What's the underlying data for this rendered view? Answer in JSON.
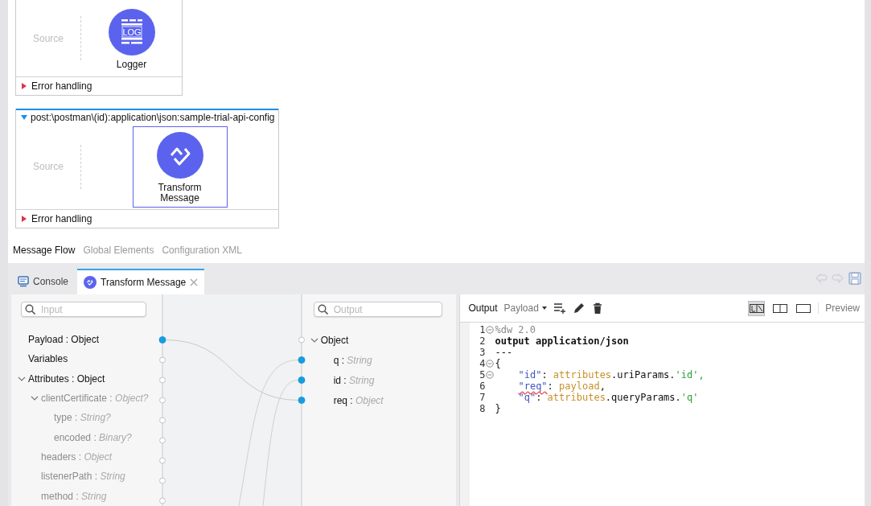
{
  "flows": [
    {
      "source_label": "Source",
      "processor": {
        "label": "Logger",
        "kind": "logger",
        "icon_text": "LOG",
        "selected": false
      },
      "error_handling": {
        "label": "Error handling",
        "expanded": false
      }
    },
    {
      "title": "post:\\postman\\(id):application\\json:sample-trial-api-config",
      "expanded": true,
      "source_label": "Source",
      "processor": {
        "label": "Transform Message",
        "kind": "transform",
        "selected": true
      },
      "error_handling": {
        "label": "Error handling",
        "expanded": false
      }
    }
  ],
  "canvas_tabs": [
    {
      "label": "Message Flow",
      "selected": true
    },
    {
      "label": "Global Elements",
      "selected": false
    },
    {
      "label": "Configuration XML",
      "selected": false
    }
  ],
  "views": [
    {
      "label": "Console",
      "kind": "console",
      "selected": false,
      "closable": false
    },
    {
      "label": "Transform Message",
      "kind": "transform",
      "selected": true,
      "closable": true
    }
  ],
  "input": {
    "search": {
      "placeholder": "Input"
    },
    "items": [
      {
        "name": "Payload : Object",
        "connected": true
      },
      {
        "name": "Variables",
        "connected": false
      },
      {
        "name": "Attributes : Object",
        "connected": false,
        "expanded": true,
        "children": [
          {
            "name": "clientCertificate :",
            "type": "Object?",
            "connected": false,
            "expanded": true,
            "children": [
              {
                "name": "type :",
                "type": "String?",
                "connected": false
              },
              {
                "name": "encoded :",
                "type": "Binary?",
                "connected": false
              }
            ]
          },
          {
            "name": "headers :",
            "type": "Object",
            "connected": false
          },
          {
            "name": "listenerPath :",
            "type": "String",
            "connected": false
          },
          {
            "name": "method :",
            "type": "String",
            "connected": false
          }
        ]
      }
    ]
  },
  "output": {
    "search": {
      "placeholder": "Output"
    },
    "items": [
      {
        "name": "Object",
        "connected": false,
        "expanded": true,
        "children": [
          {
            "name": "q :",
            "type": "String",
            "connected": true
          },
          {
            "name": "id :",
            "type": "String",
            "connected": true
          },
          {
            "name": "req :",
            "type": "Object",
            "connected": true
          }
        ]
      }
    ]
  },
  "editor": {
    "title": "Output",
    "target": "Payload",
    "view_modes": [
      {
        "kind": "diagram",
        "selected": true
      },
      {
        "kind": "split",
        "selected": false
      },
      {
        "kind": "single",
        "selected": false
      }
    ],
    "preview": "Preview",
    "lines": [
      {
        "number": "1",
        "foldable": true,
        "tokens": [
          {
            "kind": "directive",
            "text": "%dw 2.0"
          }
        ]
      },
      {
        "number": "2",
        "foldable": false,
        "tokens": [
          {
            "kind": "keyword",
            "text": "output application/json"
          }
        ]
      },
      {
        "number": "3",
        "foldable": false,
        "tokens": [
          {
            "kind": "plain",
            "text": "---"
          }
        ]
      },
      {
        "number": "4",
        "foldable": true,
        "tokens": [
          {
            "kind": "plain",
            "text": "{"
          }
        ]
      },
      {
        "number": "5",
        "foldable": true,
        "indented": true,
        "tokens": [
          {
            "kind": "key",
            "text": "\"id\""
          },
          {
            "kind": "plain",
            "text": ": "
          },
          {
            "kind": "ident",
            "text": "attributes"
          },
          {
            "kind": "plain",
            "text": ".uriParams."
          },
          {
            "kind": "string",
            "text": "'id',"
          }
        ]
      },
      {
        "number": "6",
        "foldable": false,
        "indented": true,
        "tokens": [
          {
            "kind": "key",
            "text": "\"req\"",
            "misspelled": true
          },
          {
            "kind": "plain",
            "text": ": "
          },
          {
            "kind": "ident",
            "text": "payload"
          },
          {
            "kind": "plain",
            "text": ","
          }
        ]
      },
      {
        "number": "7",
        "foldable": false,
        "indented": true,
        "tokens": [
          {
            "kind": "key",
            "text": "\"q\""
          },
          {
            "kind": "plain",
            "text": ": "
          },
          {
            "kind": "ident",
            "text": "attributes"
          },
          {
            "kind": "plain",
            "text": ".queryParams."
          },
          {
            "kind": "string",
            "text": "'q'"
          }
        ]
      },
      {
        "number": "8",
        "foldable": false,
        "tokens": [
          {
            "kind": "plain",
            "text": "}"
          }
        ]
      }
    ]
  }
}
